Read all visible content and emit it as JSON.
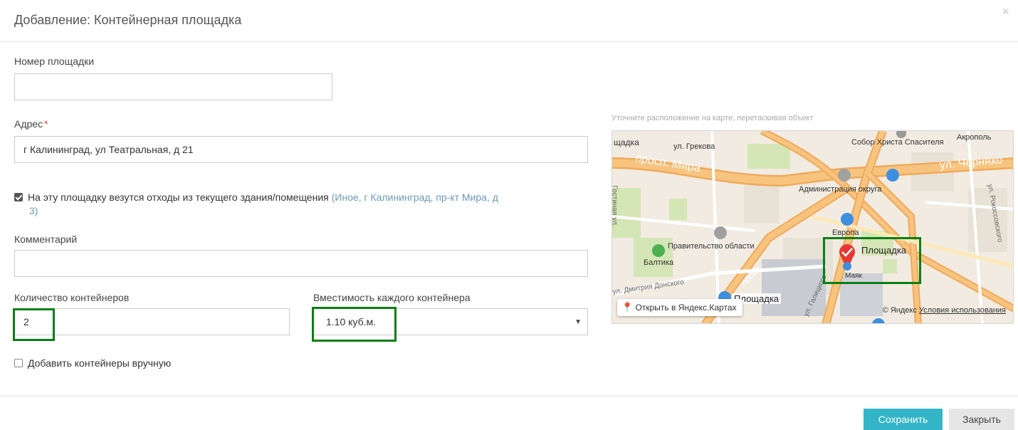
{
  "dialog": {
    "title": "Добавление: Контейнерная площадка",
    "close_icon": "×"
  },
  "form": {
    "number_label": "Номер площадки",
    "number_value": "",
    "address_label": "Адрес",
    "address_required": "*",
    "address_value": "г Калининград, ул Театральная, д 21",
    "waste_checkbox_label": "На эту площадку везутся отходы из текущего здания/помещения",
    "waste_checkbox_link_line1": "(Иное, г Калининград, пр-кт Мира, д",
    "waste_checkbox_link_line2": "3)",
    "waste_checkbox_checked": true,
    "comment_label": "Комментарий",
    "comment_value": "",
    "containers_count_label": "Количество контейнеров",
    "containers_count_value": "2",
    "capacity_label": "Вместимость каждого контейнера",
    "capacity_value": "1.10 куб.м.",
    "manual_checkbox_label": "Добавить контейнеры вручную",
    "manual_checkbox_checked": false
  },
  "map": {
    "hint": "Уточните расположение на карте, перетаскивая объект",
    "labels": {
      "square": "щадка",
      "grekova": "ул. Грекова",
      "sobor": "Собор Христа Спасителя",
      "akropol": "Акрополь",
      "prosp_mira": "просп. Мира",
      "chernyakh": "ул. Черняхо",
      "administration": "Администрация округа",
      "gostinaya": "Гостиная ул.",
      "rokossovsk": "ул. Рокоссовского",
      "europa": "Европа",
      "pravitelstvo": "Правительство области",
      "baltika": "Балтика",
      "mayak": "Маяк",
      "donskogo": "ул. Дмитрия Донского",
      "prosp": "просп.",
      "galitsk": "ул. Галицкого",
      "ploshchadka_pin": "Площадка",
      "ploshchadka_other": "Площадка"
    },
    "open_button": "Открыть в Яндекс.Картах",
    "copyright": "© Яндекс",
    "terms_link": "Условия использования"
  },
  "footer": {
    "save_label": "Сохранить",
    "close_label": "Закрыть"
  },
  "colors": {
    "accent": "#34b5c7",
    "highlight": "#0a7f15",
    "required": "#e0412b"
  }
}
